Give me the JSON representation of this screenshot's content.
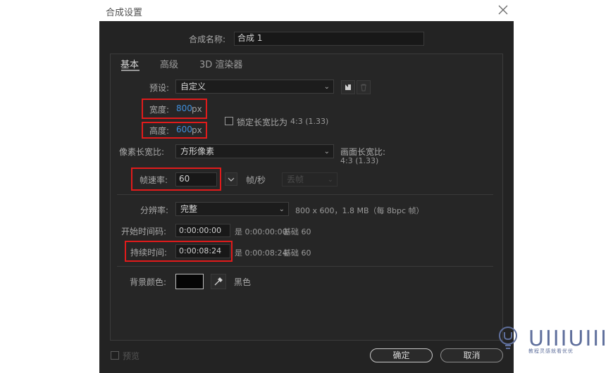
{
  "window": {
    "title": "合成设置"
  },
  "comp_name": {
    "label": "合成名称:",
    "value": "合成 1"
  },
  "tabs": [
    {
      "label": "基本",
      "active": true
    },
    {
      "label": "高级",
      "active": false
    },
    {
      "label": "3D 渲染器",
      "active": false
    }
  ],
  "preset": {
    "label": "预设:",
    "value": "自定义"
  },
  "width": {
    "label": "宽度:",
    "value": "800",
    "unit": "px"
  },
  "height": {
    "label": "高度:",
    "value": "600",
    "unit": "px"
  },
  "lock_aspect": {
    "label": "锁定长宽比为",
    "ratio": "4:3 (1.33)",
    "checked": false
  },
  "pixel_aspect": {
    "label": "像素长宽比:",
    "value": "方形像素"
  },
  "frame_aspect": {
    "label": "画面长宽比:",
    "value": "4:3 (1.33)"
  },
  "frame_rate": {
    "label": "帧速率:",
    "value": "60",
    "unit": "帧/秒",
    "drop_frame": "丢帧"
  },
  "resolution": {
    "label": "分辨率:",
    "value": "完整",
    "info": "800 x 600，1.8 MB（每 8bpc 帧）"
  },
  "start_timecode": {
    "label": "开始时间码:",
    "value": "0:00:00:00",
    "is_label": "是 0:00:00:00",
    "base": "基础 60"
  },
  "duration": {
    "label": "持续时间:",
    "value": "0:00:08:24",
    "is_label": "是 0:00:08:24",
    "base": "基础 60"
  },
  "background_color": {
    "label": "背景颜色:",
    "name": "黑色",
    "color": "#050505"
  },
  "preview": {
    "label": "预览",
    "checked": false
  },
  "buttons": {
    "ok": "确定",
    "cancel": "取消"
  },
  "watermark": {
    "brand": "UIIIUIII",
    "tagline": "教程灵感就看优优"
  },
  "colors": {
    "highlight": "#e11b1b",
    "value_blue": "#3f8edb",
    "dialog_bg": "#232323"
  },
  "icons": {
    "close": "close-icon",
    "save_preset": "save-preset-icon",
    "delete_preset": "trash-icon",
    "eyedropper": "eyedropper-icon",
    "dropdown": "chevron-down-icon"
  }
}
